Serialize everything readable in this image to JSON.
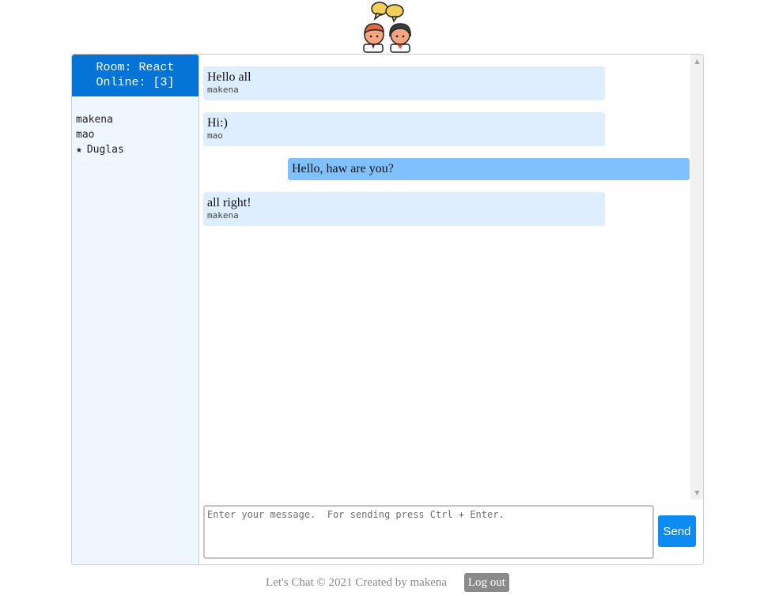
{
  "sidebar": {
    "room_line": "Room: React",
    "online_line": "Online: [3]",
    "users": [
      {
        "name": "makena"
      },
      {
        "name": "mao"
      },
      {
        "name": "Duglas",
        "marker": "★"
      }
    ]
  },
  "messages": [
    {
      "text": "Hello all",
      "author": "makena",
      "own": false
    },
    {
      "text": "Hi:)",
      "author": "mao",
      "own": false
    },
    {
      "text": "Hello, haw are you?",
      "author": "",
      "own": true
    },
    {
      "text": "all right!",
      "author": "makena",
      "own": false
    }
  ],
  "composer": {
    "placeholder": "Enter your message.  For sending press Ctrl + Enter.",
    "send_label": "Send"
  },
  "footer": {
    "copyright": "Let's Chat © 2021 Created by makena",
    "logout_label": "Log out"
  },
  "colors": {
    "header_blue": "#0474d6",
    "own_message": "#80c1fd",
    "other_message": "#deeeff",
    "send_button": "#0d8bf0",
    "sidebar_bg": "#eef7ff"
  },
  "icons": {
    "logo": "two-people-chatting-icon",
    "scroll_up": "scroll-up-arrow-icon",
    "scroll_down": "scroll-down-arrow-icon",
    "star": "star-icon"
  }
}
